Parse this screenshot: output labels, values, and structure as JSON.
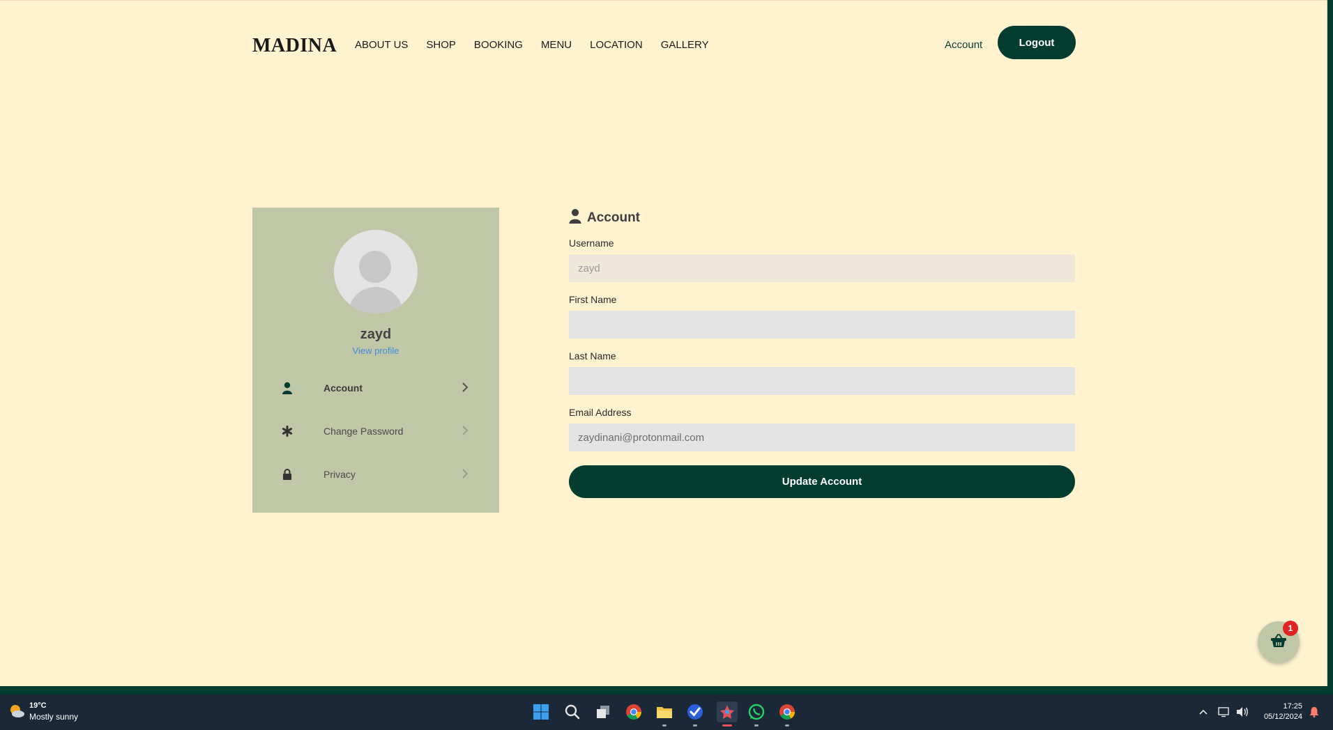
{
  "nav": {
    "logo": "MADINA",
    "links": [
      "ABOUT US",
      "SHOP",
      "BOOKING",
      "MENU",
      "LOCATION",
      "GALLERY"
    ],
    "account_label": "Account",
    "logout_label": "Logout"
  },
  "profile": {
    "username": "zayd",
    "view_profile": "View profile",
    "menu": [
      {
        "label": "Account",
        "icon": "user-icon",
        "active": true
      },
      {
        "label": "Change Password",
        "icon": "asterisk-icon",
        "active": false
      },
      {
        "label": "Privacy",
        "icon": "lock-icon",
        "active": false
      }
    ]
  },
  "form": {
    "title": "Account",
    "username_label": "Username",
    "username_value": "zayd",
    "first_name_label": "First Name",
    "first_name_value": "",
    "last_name_label": "Last Name",
    "last_name_value": "",
    "email_label": "Email Address",
    "email_value": "zaydinani@protonmail.com",
    "submit_label": "Update Account"
  },
  "cart": {
    "count": "1",
    "icon": "basket-icon"
  },
  "taskbar": {
    "temperature": "19°C",
    "weather": "Mostly sunny",
    "time": "17:25",
    "date": "05/12/2024",
    "apps": [
      "windows-start-icon",
      "search-icon",
      "task-view-icon",
      "chrome-icon",
      "file-explorer-icon",
      "todo-icon",
      "app-icon",
      "whatsapp-icon",
      "chrome-alt-icon"
    ]
  },
  "colors": {
    "background": "#fff3d0",
    "brand_green": "#043d30",
    "card_green": "#c0c7a7",
    "link_blue": "#3f8fd8",
    "badge_red": "#e02424"
  }
}
